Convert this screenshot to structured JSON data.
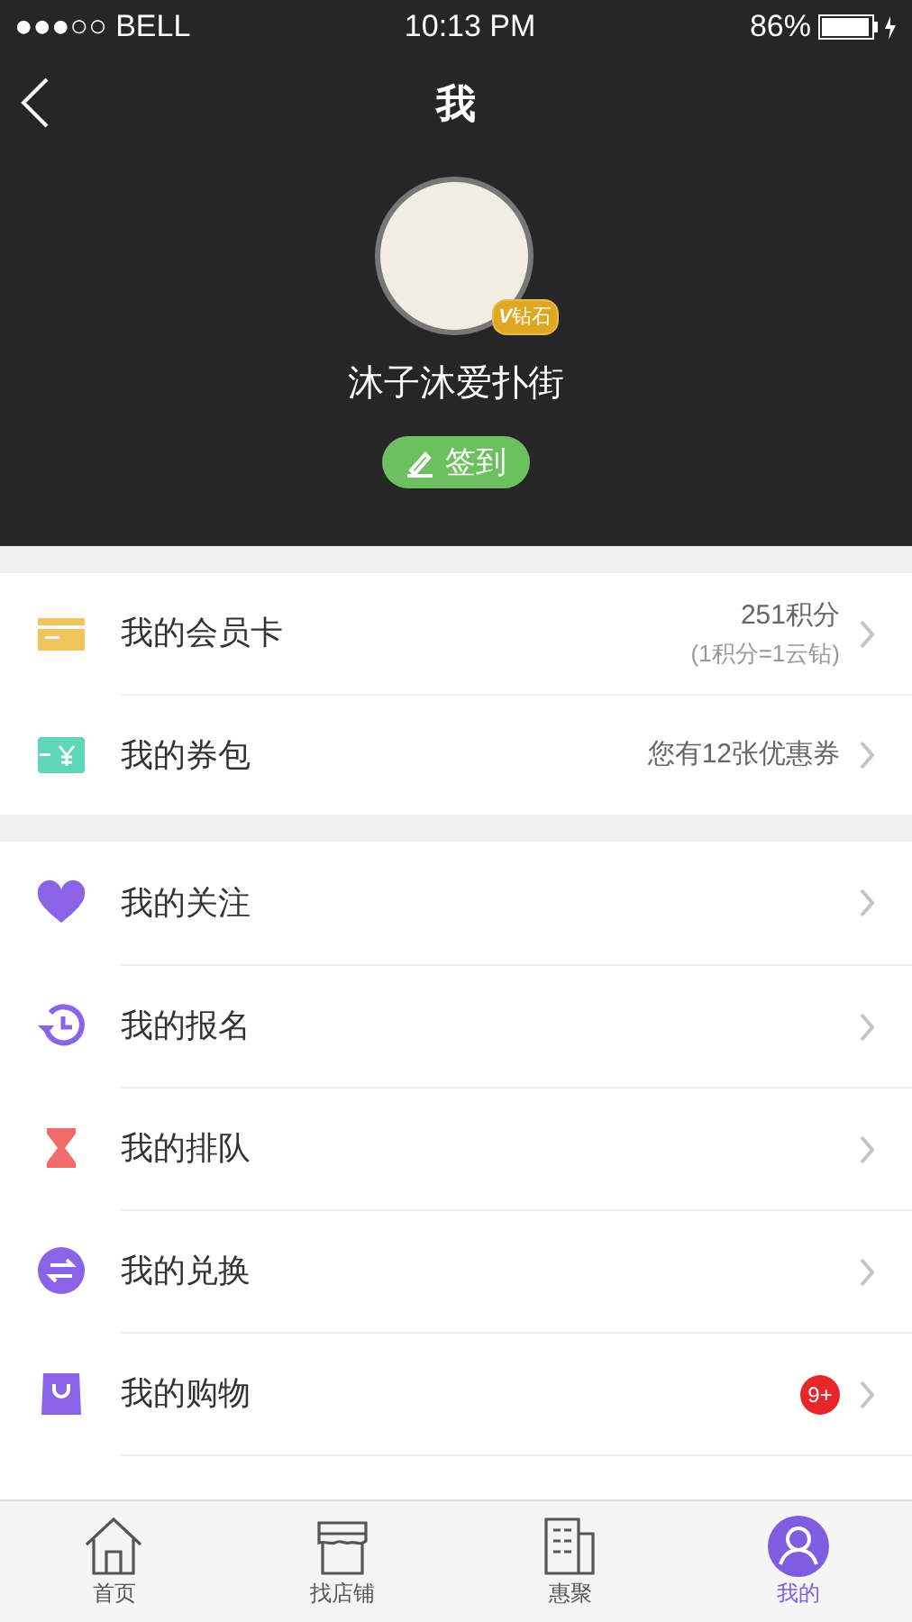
{
  "status_bar": {
    "carrier": "●●●○○ BELL",
    "time": "10:13 PM",
    "battery": "86%"
  },
  "header": {
    "title": "我",
    "user_name": "沐子沐爱扑街",
    "badge": "钻石",
    "badge_mark": "V",
    "checkin_button": "签到"
  },
  "card_section": [
    {
      "kind": "card",
      "label": "我的会员卡",
      "value": "251积分",
      "note": "(1积分=1云钻)"
    },
    {
      "kind": "coupon",
      "label": "我的券包",
      "value": "您有12张优惠券"
    }
  ],
  "menu": [
    {
      "kind": "heart",
      "label": "我的关注"
    },
    {
      "kind": "history",
      "label": "我的报名"
    },
    {
      "kind": "hourglass",
      "label": "我的排队"
    },
    {
      "kind": "exchange",
      "label": "我的兑换"
    },
    {
      "kind": "bag",
      "label": "我的购物",
      "badge": "9+"
    }
  ],
  "tab_bar": [
    {
      "kind": "home",
      "label": "首页",
      "selected": false
    },
    {
      "kind": "store",
      "label": "找店铺",
      "selected": false
    },
    {
      "kind": "building",
      "label": "惠聚",
      "selected": false
    },
    {
      "kind": "user",
      "label": "我的",
      "selected": true
    }
  ]
}
